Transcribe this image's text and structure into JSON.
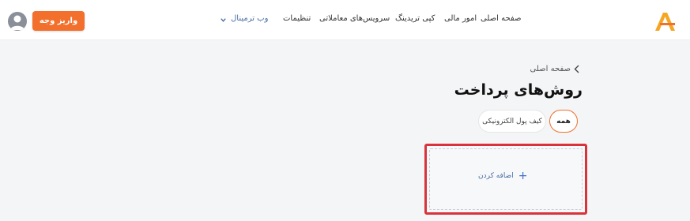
{
  "header": {
    "deposit_label": "واریز وجه",
    "nav": {
      "home": "صفحه اصلی",
      "finance": "امور مالی",
      "copy_trading": "کپی تریدینگ",
      "trade_services": "سرویس‌های معاملاتی",
      "settings": "تنظیمات",
      "web_terminal": "وب ترمینال"
    }
  },
  "breadcrumb": {
    "home": "صفحه اصلی"
  },
  "page": {
    "title": "روش‌های پرداخت",
    "tabs": {
      "all": "همه",
      "ewallet": "کیف پول الکترونیکی"
    },
    "add_label": "اضافه کردن"
  },
  "colors": {
    "accent": "#f26f2c",
    "highlight_border": "#d9323a",
    "link": "#3f6fd1"
  }
}
